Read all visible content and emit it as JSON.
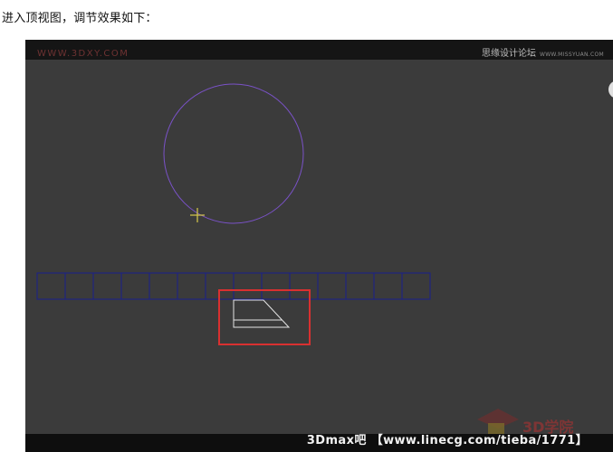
{
  "caption": "进入顶视图，调节效果如下：",
  "viewport": {
    "watermark_left": "WWW.3DXY.COM",
    "watermark_right": "思缘设计论坛",
    "watermark_right_sub": "WWW.MISSYUAN.COM",
    "footer": "3Dmax吧 【www.linecg.com/tieba/1771】",
    "logo_text": "3D学院",
    "grid_cells": 14
  },
  "colors": {
    "viewport_bg": "#3b3b3b",
    "circle_stroke": "#7a52c8",
    "grid_stroke": "#1a1f8c",
    "highlight_box": "#d93030",
    "pivot_cross": "#d8c84a",
    "shape_stroke": "#e6e6e6"
  }
}
